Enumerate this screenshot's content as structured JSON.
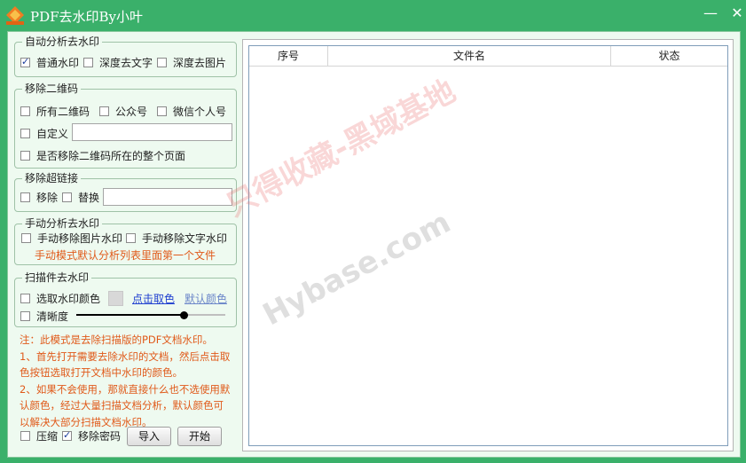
{
  "title": "PDF去水印By小叶",
  "controls": {
    "minimize": "—",
    "close": "✕"
  },
  "auto": {
    "legend": "自动分析去水印",
    "normal_label": "普通水印",
    "normal_checked": true,
    "deep_text_label": "深度去文字",
    "deep_text_checked": false,
    "deep_image_label": "深度去图片",
    "deep_image_checked": false
  },
  "qr": {
    "legend": "移除二维码",
    "all_label": "所有二维码",
    "public_label": "公众号",
    "wechat_label": "微信个人号",
    "custom_label": "自定义",
    "custom_value": "",
    "page_label": "是否移除二维码所在的整个页面"
  },
  "link": {
    "legend": "移除超链接",
    "remove_label": "移除",
    "replace_label": "替换",
    "replace_value": ""
  },
  "manual": {
    "legend": "手动分析去水印",
    "image_label": "手动移除图片水印",
    "text_label": "手动移除文字水印",
    "hint": "手动模式默认分析列表里面第一个文件"
  },
  "scan": {
    "legend": "扫描件去水印",
    "color_label": "选取水印颜色",
    "pick_link": "点击取色",
    "default_link": "默认颜色",
    "clarity_label": "清晰度",
    "clarity_value": 0.72
  },
  "note": {
    "line1": "注：此模式是去除扫描版的PDF文档水印。",
    "line2": "1、首先打开需要去除水印的文档，然后点击取色按钮选取打开文档中水印的颜色。",
    "line3": "2、如果不会使用，那就直接什么也不选使用默认颜色，经过大量扫描文档分析，默认颜色可以解决大部分扫描文档水印。"
  },
  "bottom": {
    "compress_label": "压缩",
    "compress_checked": false,
    "remove_pwd_label": "移除密码",
    "remove_pwd_checked": true,
    "import_label": "导入",
    "start_label": "开始"
  },
  "table": {
    "columns": [
      "序号",
      "文件名",
      "状态"
    ],
    "rows": []
  },
  "watermark": {
    "cn": "只得收藏-黑域基地",
    "en": "Hybase.com"
  },
  "colors": {
    "window": "#3ab06a",
    "client": "#eefaf0",
    "note": "#e05a1a",
    "link": "#1f3fcf"
  },
  "icons": [
    "app-diamond-icon",
    "minimize-icon",
    "close-icon"
  ]
}
